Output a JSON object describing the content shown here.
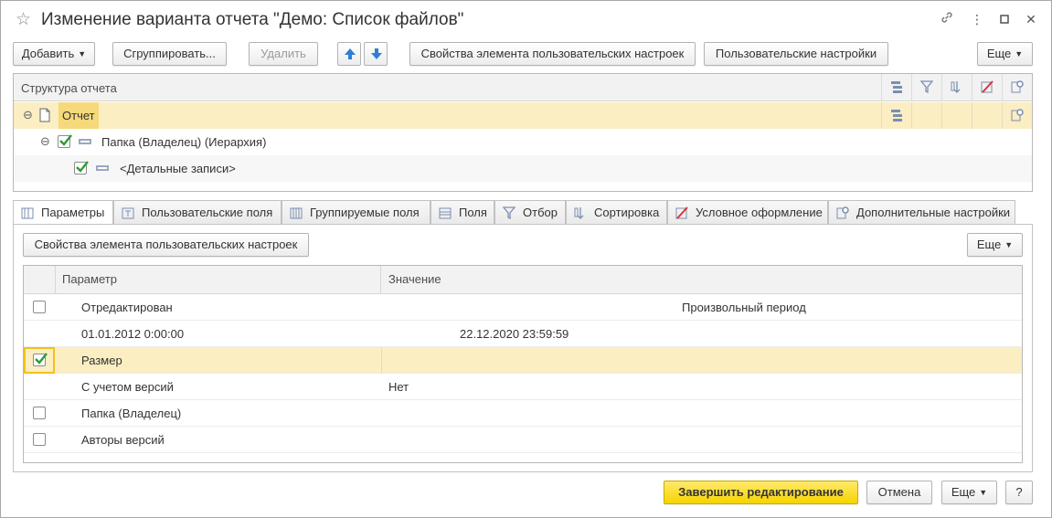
{
  "window": {
    "title": "Изменение варианта отчета \"Демо: Список файлов\""
  },
  "toolbar": {
    "add": "Добавить",
    "group": "Сгруппировать...",
    "delete": "Удалить",
    "element_settings": "Свойства элемента пользовательских настроек",
    "user_settings": "Пользовательские настройки",
    "more": "Еще"
  },
  "structure": {
    "header": "Структура отчета",
    "rows": [
      {
        "label": "Отчет"
      },
      {
        "label": "Папка (Владелец) (Иерархия)",
        "checked": true
      },
      {
        "label": "<Детальные записи>",
        "checked": true
      }
    ]
  },
  "tabs": [
    {
      "label": "Параметры",
      "icon": "parameters-icon"
    },
    {
      "label": "Пользовательские поля",
      "icon": "user-fields-icon"
    },
    {
      "label": "Группируемые поля",
      "icon": "grouping-fields-icon"
    },
    {
      "label": "Поля",
      "icon": "fields-icon"
    },
    {
      "label": "Отбор",
      "icon": "filter-icon"
    },
    {
      "label": "Сортировка",
      "icon": "sort-icon"
    },
    {
      "label": "Условное оформление",
      "icon": "conditional-format-icon"
    },
    {
      "label": "Дополнительные настройки",
      "icon": "additional-settings-icon"
    }
  ],
  "params_toolbar": {
    "element_settings": "Свойства элемента пользовательских настроек",
    "more": "Еще"
  },
  "params_table": {
    "headers": {
      "param": "Параметр",
      "value": "Значение"
    },
    "rows": [
      {
        "checked": false,
        "param": "Отредактирован",
        "value": "",
        "extra": "Произвольный период"
      },
      {
        "checked": null,
        "param": "01.01.2012 0:00:00",
        "value": "22.12.2020 23:59:59",
        "extra": ""
      },
      {
        "checked": true,
        "param": "Размер",
        "value": "",
        "extra": ""
      },
      {
        "checked": null,
        "param": "С учетом версий",
        "value": "Нет",
        "extra": ""
      },
      {
        "checked": false,
        "param": "Папка (Владелец)",
        "value": "",
        "extra": ""
      },
      {
        "checked": false,
        "param": "Авторы версий",
        "value": "",
        "extra": ""
      }
    ]
  },
  "footer": {
    "finish": "Завершить редактирование",
    "cancel": "Отмена",
    "more": "Еще",
    "help": "?"
  },
  "colors": {
    "accent_yellow": "#f6d400",
    "selection": "#fbeec2",
    "check_green": "#2e9a35",
    "arrow_blue": "#2f7fd4"
  }
}
